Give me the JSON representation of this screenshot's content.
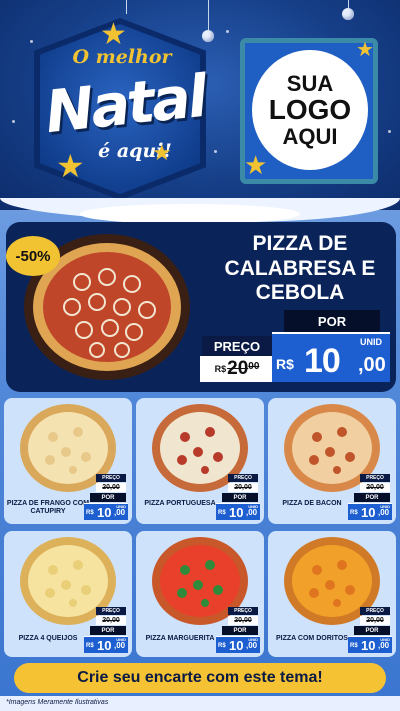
{
  "header": {
    "badge_top": "O melhor",
    "badge_main": "Natal",
    "badge_sub": "é aqui!",
    "logo_lines": [
      "SUA",
      "LOGO",
      "AQUI"
    ]
  },
  "featured": {
    "discount": "-50%",
    "title": "PIZZA DE CALABRESA E CEBOLA",
    "por_label": "POR",
    "preco_label": "PREÇO",
    "old_currency": "R$",
    "old_int": "20",
    "old_cents": "00",
    "new_currency": "R$",
    "new_int": "10",
    "new_cents": ",00",
    "unit": "UNID"
  },
  "products": [
    {
      "name": "PIZZA DE FRANGO COM CATUPIRY",
      "preco_label": "PREÇO",
      "old_price": "20,00",
      "por_label": "POR",
      "currency": "R$",
      "int": "10",
      "cents": ",00",
      "unit": "UNID"
    },
    {
      "name": "PIZZA PORTUGUESA",
      "preco_label": "PREÇO",
      "old_price": "20,00",
      "por_label": "POR",
      "currency": "R$",
      "int": "10",
      "cents": ",00",
      "unit": "UNID"
    },
    {
      "name": "PIZZA DE BACON",
      "preco_label": "PREÇO",
      "old_price": "20,00",
      "por_label": "POR",
      "currency": "R$",
      "int": "10",
      "cents": ",00",
      "unit": "UNID"
    },
    {
      "name": "PIZZA 4 QUEIJOS",
      "preco_label": "PREÇO",
      "old_price": "20,00",
      "por_label": "POR",
      "currency": "R$",
      "int": "10",
      "cents": ",00",
      "unit": "UNID"
    },
    {
      "name": "PIZZA MARGUERITA",
      "preco_label": "PREÇO",
      "old_price": "20,00",
      "por_label": "POR",
      "currency": "R$",
      "int": "10",
      "cents": ",00",
      "unit": "UNID"
    },
    {
      "name": "PIZZA COM DORITOS",
      "preco_label": "PREÇO",
      "old_price": "20,00",
      "por_label": "POR",
      "currency": "R$",
      "int": "10",
      "cents": ",00",
      "unit": "UNID"
    }
  ],
  "cta": "Crie seu encarte com este tema!",
  "footnote": "*Imagens Meramente Ilustrativas",
  "colors": {
    "gold": "#f1c232",
    "navy": "#0a2358",
    "blue": "#1d5fd0",
    "card": "#cfe2fb"
  },
  "icons": [
    "star-icon",
    "ornament-icon",
    "pizza-image"
  ]
}
